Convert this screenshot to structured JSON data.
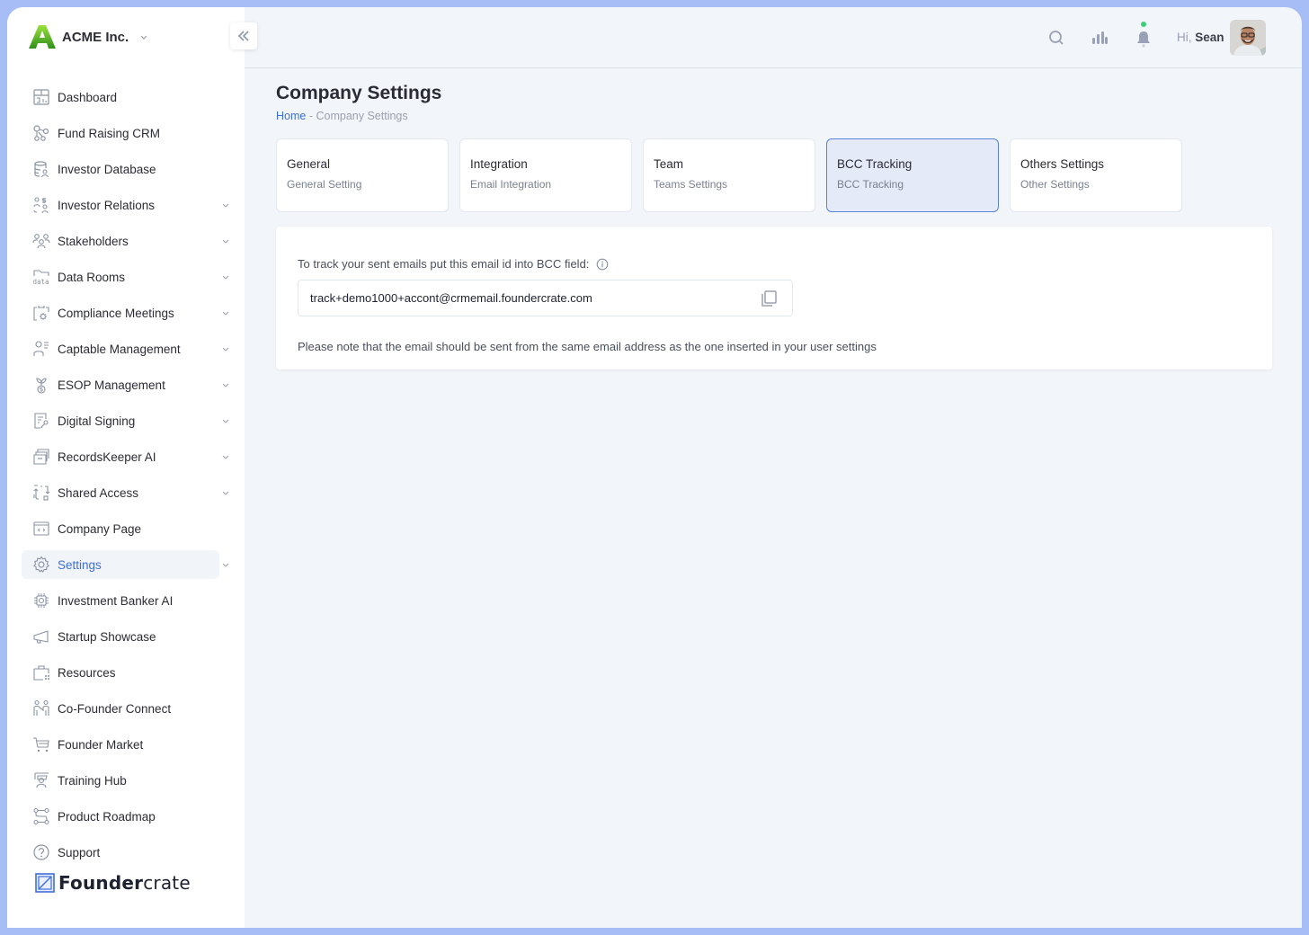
{
  "company": {
    "name": "ACME Inc."
  },
  "sidebar": {
    "items": [
      {
        "label": "Dashboard",
        "icon": "dashboard-icon",
        "has_submenu": false
      },
      {
        "label": "Fund Raising CRM",
        "icon": "crm-nodes-icon",
        "has_submenu": false
      },
      {
        "label": "Investor Database",
        "icon": "database-user-icon",
        "has_submenu": false
      },
      {
        "label": "Investor Relations",
        "icon": "investor-relations-icon",
        "has_submenu": true
      },
      {
        "label": "Stakeholders",
        "icon": "stakeholders-icon",
        "has_submenu": true
      },
      {
        "label": "Data Rooms",
        "icon": "data-folder-icon",
        "has_submenu": true
      },
      {
        "label": "Compliance Meetings",
        "icon": "calendar-gear-icon",
        "has_submenu": true
      },
      {
        "label": "Captable Management",
        "icon": "user-list-icon",
        "has_submenu": true
      },
      {
        "label": "ESOP Management",
        "icon": "plant-coin-icon",
        "has_submenu": true
      },
      {
        "label": "Digital Signing",
        "icon": "document-pen-icon",
        "has_submenu": true
      },
      {
        "label": "RecordsKeeper AI",
        "icon": "archive-box-icon",
        "has_submenu": true
      },
      {
        "label": "Shared Access",
        "icon": "share-arrows-icon",
        "has_submenu": true
      },
      {
        "label": "Company Page",
        "icon": "browser-code-icon",
        "has_submenu": false
      },
      {
        "label": "Settings",
        "icon": "gear-icon",
        "has_submenu": true,
        "active": true
      },
      {
        "label": "Investment Banker AI",
        "icon": "chip-icon",
        "has_submenu": false
      },
      {
        "label": "Startup Showcase",
        "icon": "megaphone-icon",
        "has_submenu": false
      },
      {
        "label": "Resources",
        "icon": "briefcase-icon",
        "has_submenu": false
      },
      {
        "label": "Co-Founder Connect",
        "icon": "two-people-icon",
        "has_submenu": false
      },
      {
        "label": "Founder Market",
        "icon": "cart-icon",
        "has_submenu": false
      },
      {
        "label": "Training Hub",
        "icon": "teacher-icon",
        "has_submenu": false
      },
      {
        "label": "Product Roadmap",
        "icon": "roadmap-icon",
        "has_submenu": false
      },
      {
        "label": "Support",
        "icon": "help-circle-icon",
        "has_submenu": false
      }
    ],
    "footer_brand": {
      "bold": "Founder",
      "light": "crate"
    }
  },
  "header": {
    "greeting_prefix": "Hi,",
    "user_name": "Sean",
    "notification_dot_color": "#3ccf7a"
  },
  "page": {
    "title": "Company Settings",
    "breadcrumb": {
      "home": "Home",
      "separator": "-",
      "current": "Company Settings"
    }
  },
  "tabs": [
    {
      "title": "General",
      "subtitle": "General Setting",
      "active": false
    },
    {
      "title": "Integration",
      "subtitle": "Email Integration",
      "active": false
    },
    {
      "title": "Team",
      "subtitle": "Teams Settings",
      "active": false
    },
    {
      "title": "BCC Tracking",
      "subtitle": "BCC Tracking",
      "active": true
    },
    {
      "title": "Others Settings",
      "subtitle": "Other Settings",
      "active": false
    }
  ],
  "bcc": {
    "label": "To track your sent emails put this email id into BCC field:",
    "email": "track+demo1000+accont@crmemail.foundercrate.com",
    "note": "Please note that the email should be sent from the same email address as the one inserted in your user settings"
  },
  "colors": {
    "accent": "#3f6fd8",
    "active_tab_bg": "#e4eaf7",
    "frame": "#a6bdf5"
  }
}
